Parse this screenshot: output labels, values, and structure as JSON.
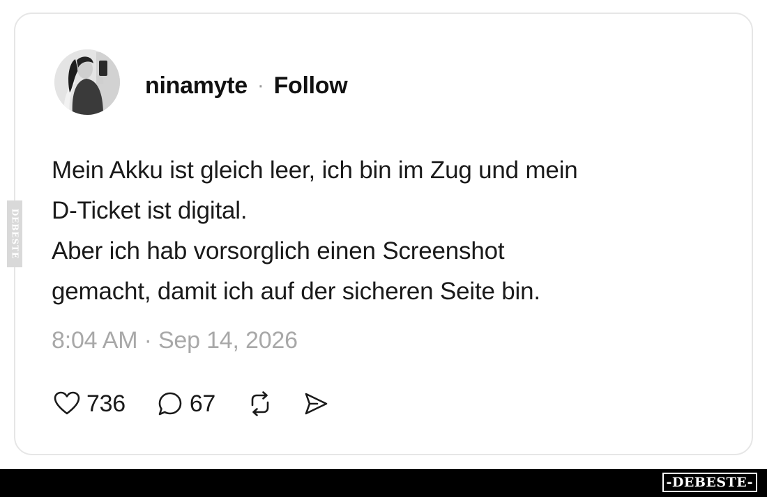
{
  "post": {
    "username": "ninamyte",
    "separator": "·",
    "follow_label": "Follow",
    "text_lines": [
      "Mein Akku ist gleich leer, ich bin im Zug und mein",
      "D-Ticket ist digital.",
      "Aber ich hab vorsorglich einen Screenshot",
      "gemacht, damit ich auf der sicheren Seite bin."
    ],
    "timestamp": "8:04 AM · Sep 14, 2026"
  },
  "actions": {
    "like_count": "736",
    "reply_count": "67",
    "icons": [
      "heart-icon",
      "speech-bubble-icon",
      "repost-icon",
      "send-icon"
    ]
  },
  "watermark": {
    "side_text": "DEBESTE",
    "bottom_text": "-DEBESTE-"
  },
  "colors": {
    "text": "#1a1a1a",
    "muted": "#a8a8a8",
    "card_border": "#e6e6e6",
    "bottom_bar": "#000000"
  }
}
